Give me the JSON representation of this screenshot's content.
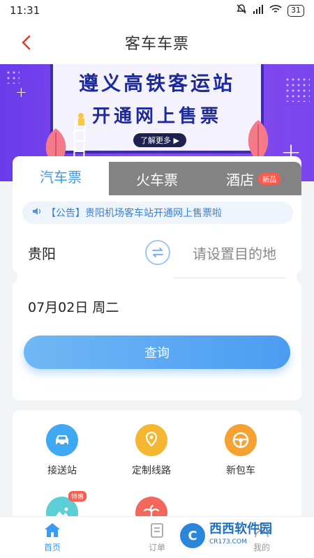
{
  "status": {
    "time": "11:31",
    "battery": "31"
  },
  "header": {
    "title": "客车车票"
  },
  "banner": {
    "line1": "遵义高铁客运站",
    "line2": "开通网上售票",
    "more": "了解更多 ▶"
  },
  "tabs": [
    {
      "label": "汽车票"
    },
    {
      "label": "火车票"
    },
    {
      "label": "酒店",
      "badge": "新品"
    }
  ],
  "notice": {
    "text": "【公告】贵阳机场客车站开通网上售票啦"
  },
  "route": {
    "from": "贵阳",
    "to_placeholder": "请设置目的地"
  },
  "date": {
    "text": "07月02日 周二"
  },
  "query_button": {
    "label": "查询"
  },
  "services": [
    {
      "label": "接送站",
      "icon": "car-icon",
      "color": "#3fa8f2"
    },
    {
      "label": "定制线路",
      "icon": "map-pin-icon",
      "color": "#f5b731"
    },
    {
      "label": "新包车",
      "icon": "steering-wheel-icon",
      "color": "#f5a233"
    },
    {
      "label": "",
      "icon": "landscape-icon",
      "color": "#5ccfd6",
      "tag": "特惠"
    },
    {
      "label": "",
      "icon": "palm-tree-icon",
      "color": "#f4685c"
    }
  ],
  "bottom_nav": [
    {
      "label": "首页"
    },
    {
      "label": "订单"
    },
    {
      "label": "我的"
    }
  ],
  "watermark": {
    "name": "西西软件园",
    "url": "CR173.COM"
  },
  "colors": {
    "accent": "#3a9bf0",
    "banner": "#7a45ee",
    "badge": "#ff5a4e"
  }
}
